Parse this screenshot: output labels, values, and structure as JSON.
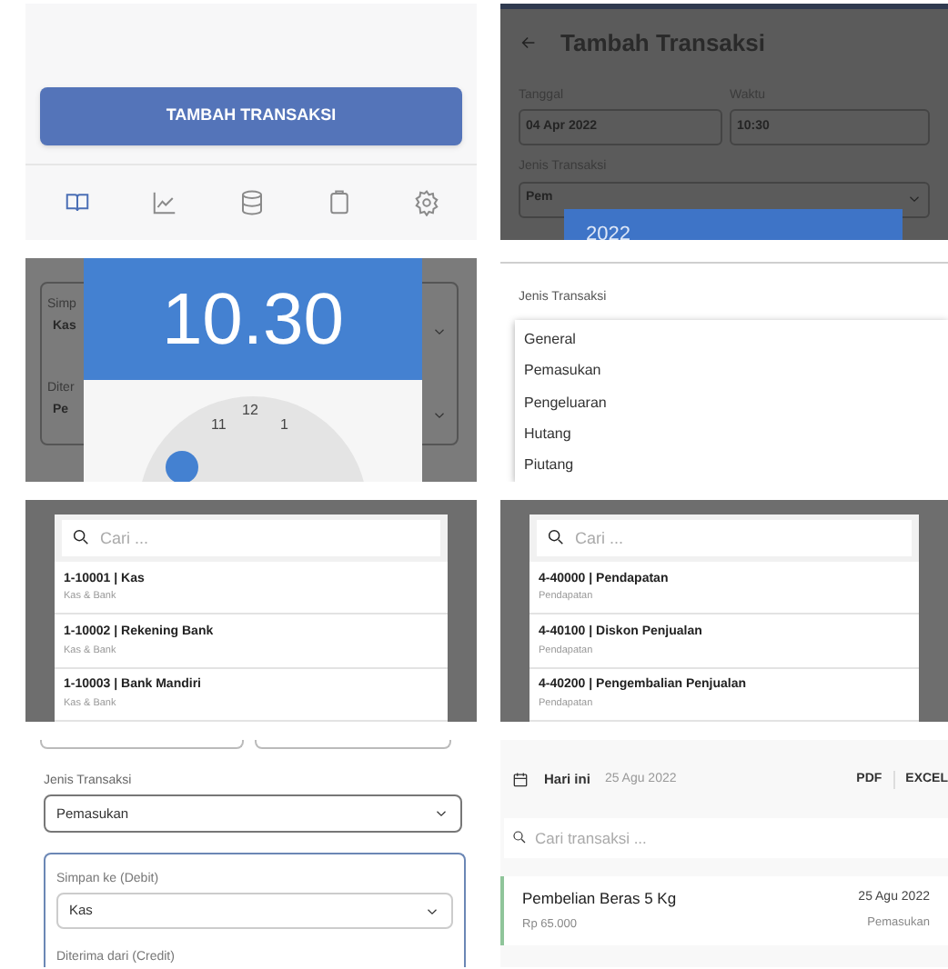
{
  "tiles": [
    {
      "kind": "home",
      "button": "TAMBAH TRANSAKSI",
      "nav": [
        {
          "selected": true
        },
        {
          "selected": false
        },
        {
          "selected": false
        },
        {
          "selected": false
        },
        {
          "selected": false
        }
      ]
    },
    {
      "kind": "form_dimmed",
      "title": "Tambah Transaksi",
      "fields": [
        {
          "label": "Tanggal",
          "value": "04 Apr 2022"
        },
        {
          "label": "Waktu",
          "value": "10:30"
        }
      ],
      "type_label": "Jenis Transaksi",
      "type_value": "Pem",
      "popup": "2022"
    },
    {
      "kind": "time_picker",
      "background": [
        {
          "label": "Simp",
          "value": "Kas"
        },
        {
          "label": "Diter",
          "value": "Pe"
        }
      ],
      "time": "10.30",
      "clock_numbers": [
        "11",
        "12",
        "1"
      ]
    },
    {
      "kind": "dropdown",
      "label": "Jenis Transaksi",
      "options": [
        "General",
        "Pemasukan",
        "Pengeluaran",
        "Hutang",
        "Piutang"
      ]
    },
    {
      "kind": "account_search",
      "placeholder": "Cari ...",
      "accounts": [
        {
          "name": "1-10001 | Kas",
          "group": "Kas & Bank"
        },
        {
          "name": "1-10002 | Rekening Bank",
          "group": "Kas & Bank"
        },
        {
          "name": "1-10003 | Bank Mandiri",
          "group": "Kas & Bank"
        }
      ]
    },
    {
      "kind": "account_search",
      "placeholder": "Cari ...",
      "accounts": [
        {
          "name": "4-40000 | Pendapatan",
          "group": "Pendapatan"
        },
        {
          "name": "4-40100 | Diskon Penjualan",
          "group": "Pendapatan"
        },
        {
          "name": "4-40200 | Pengembalian Penjualan",
          "group": "Pendapatan"
        }
      ]
    },
    {
      "kind": "form",
      "type_label": "Jenis Transaksi",
      "type_value": "Pemasukan",
      "debit_label": "Simpan ke (Debit)",
      "debit_value": "Kas",
      "credit_label": "Diterima dari (Credit)"
    },
    {
      "kind": "transactions",
      "period": "Hari ini",
      "date": "25 Agu 2022",
      "exports": [
        "PDF",
        "EXCEL"
      ],
      "placeholder": "Cari transaksi ...",
      "items": [
        {
          "title": "Pembelian Beras 5 Kg",
          "amount": "Rp 65.000",
          "date": "25 Agu 2022",
          "type": "Pemasukan"
        }
      ]
    }
  ]
}
